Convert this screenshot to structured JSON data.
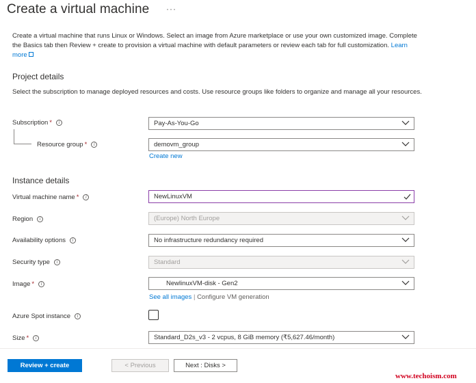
{
  "header": {
    "title": "Create a virtual machine",
    "more": "···"
  },
  "intro": {
    "text": "Create a virtual machine that runs Linux or Windows. Select an image from Azure marketplace or use your own customized image. Complete the Basics tab then Review + create to provision a virtual machine with default parameters or review each tab for full customization.",
    "learn_more": "Learn more"
  },
  "project_details": {
    "heading": "Project details",
    "description": "Select the subscription to manage deployed resources and costs. Use resource groups like folders to organize and manage all your resources.",
    "subscription": {
      "label": "Subscription",
      "required": "*",
      "value": "Pay-As-You-Go"
    },
    "resource_group": {
      "label": "Resource group",
      "required": "*",
      "value": "demovm_group",
      "create_new": "Create new"
    }
  },
  "instance_details": {
    "heading": "Instance details",
    "vm_name": {
      "label": "Virtual machine name",
      "required": "*",
      "value": "NewLinuxVM"
    },
    "region": {
      "label": "Region",
      "value": "(Europe) North Europe"
    },
    "availability": {
      "label": "Availability options",
      "value": "No infrastructure redundancy required"
    },
    "security": {
      "label": "Security type",
      "value": "Standard"
    },
    "image": {
      "label": "Image",
      "required": "*",
      "value": "NewlinuxVM-disk - Gen2",
      "see_all": "See all images",
      "separator": "|",
      "configure": "Configure VM generation"
    },
    "spot": {
      "label": "Azure Spot instance"
    },
    "size": {
      "label": "Size",
      "required": "*",
      "value": "Standard_D2s_v3 - 2 vcpus, 8 GiB memory (₹5,627.46/month)"
    }
  },
  "footer": {
    "review_create": "Review + create",
    "previous": "< Previous",
    "next": "Next : Disks >"
  },
  "watermark": "www.techoism.com",
  "colors": {
    "accent": "#0078d4",
    "required": "#a4262c",
    "focus_border": "#8a3ea8",
    "watermark": "#d1001f"
  }
}
